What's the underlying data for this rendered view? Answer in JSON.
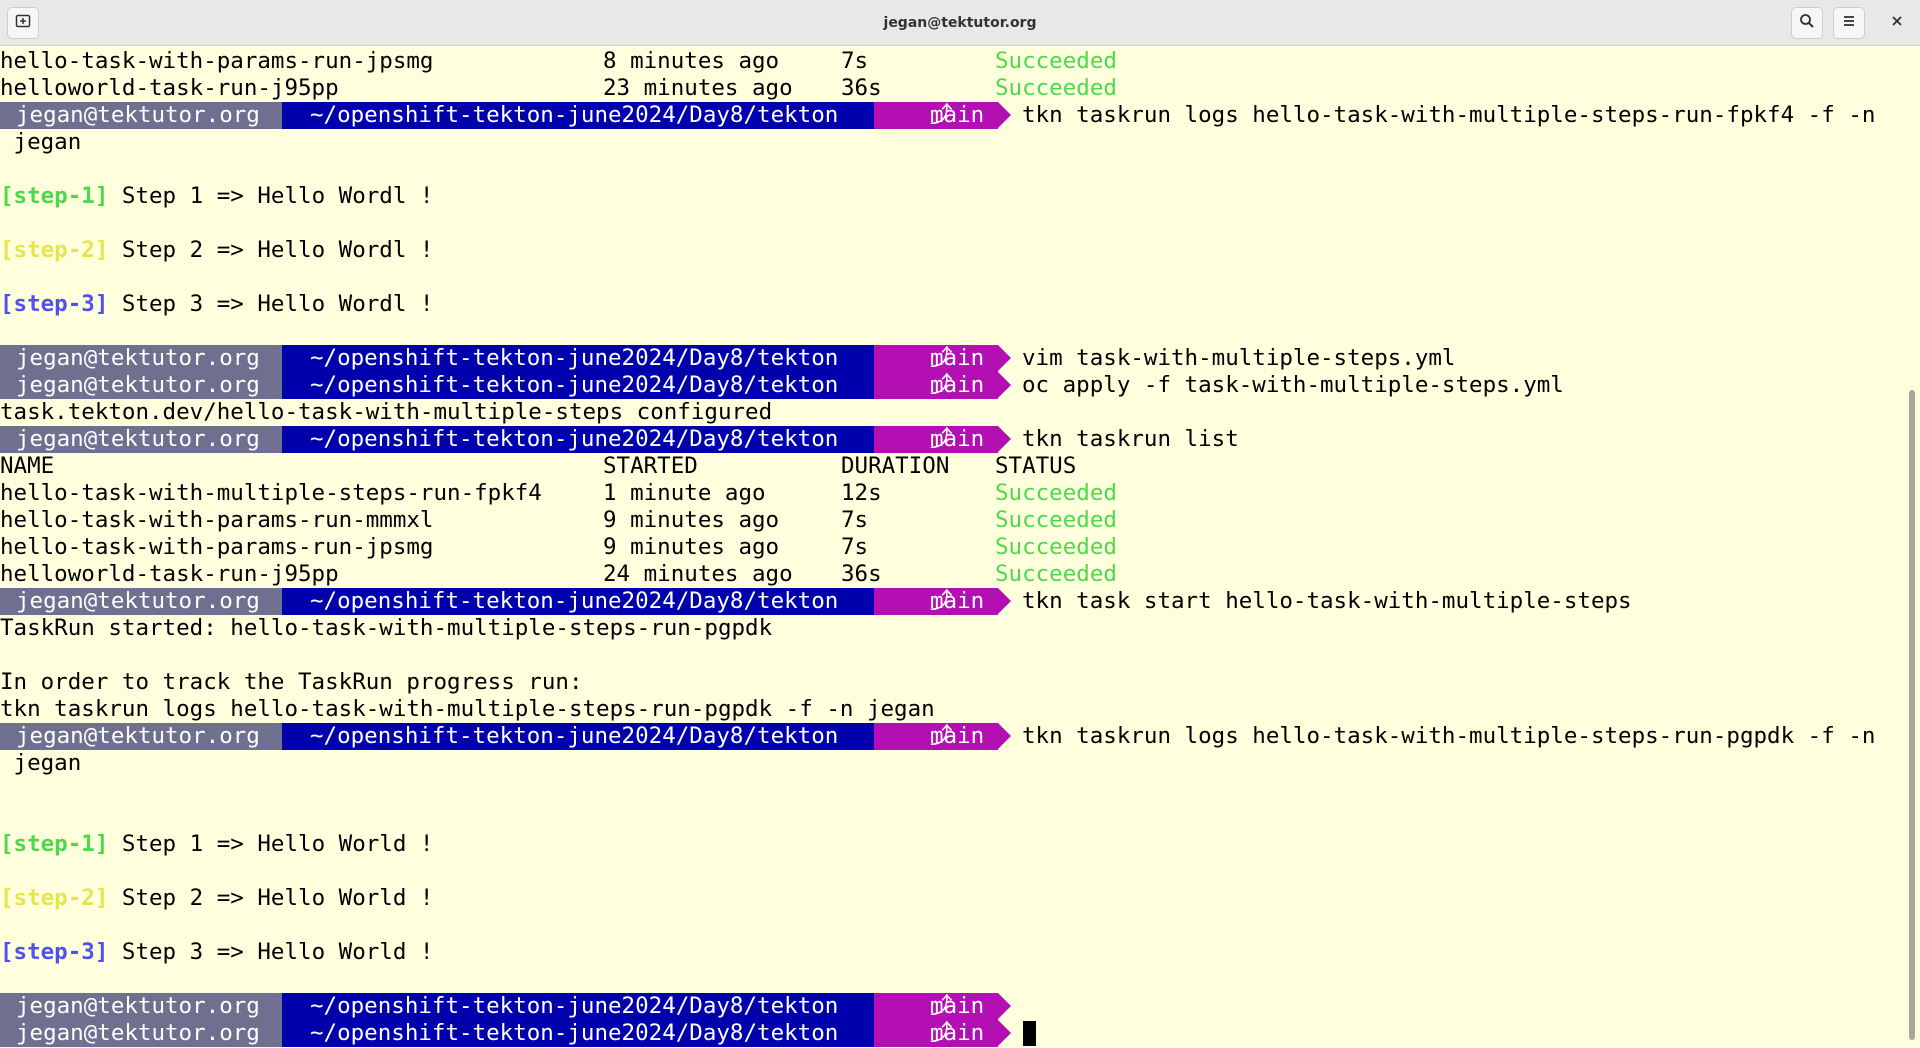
{
  "window": {
    "title": "jegan@tektutor.org"
  },
  "titlebar": {
    "new_tab_icon": "new-tab-icon",
    "search_icon": "search-icon",
    "menu_icon": "hamburger-menu-icon",
    "close_icon": "close-icon"
  },
  "prompt": {
    "user": "jegan@tektutor.org",
    "path": "~/openshift-tekton-june2024/Day8/tekton",
    "branch_glyph": "⤴",
    "branch": "main",
    "colors": {
      "user_bg": "#6f6f8f",
      "path_bg": "#0000ad",
      "git_bg": "#b30fb3",
      "text": "#ffffff"
    }
  },
  "colors": {
    "background": "#ffffdd",
    "succeeded": "#4cd94c",
    "step1": "#4cd94c",
    "step2": "#e6e64c",
    "step3": "#5050f0"
  },
  "terminal": {
    "top_list": [
      {
        "name": "hello-task-with-params-run-jpsmg",
        "started": "8 minutes ago",
        "duration": "7s",
        "status": "Succeeded"
      },
      {
        "name": "helloworld-task-run-j95pp",
        "started": "23 minutes ago",
        "duration": "36s",
        "status": "Succeeded"
      }
    ],
    "cmd1": "tkn taskrun logs hello-task-with-multiple-steps-run-fpkf4 -f -n",
    "cmd1_wrap": " jegan",
    "logs1": [
      {
        "tag": "[step-1]",
        "text": " Step 1 => Hello Wordl !"
      },
      {
        "tag": "[step-2]",
        "text": " Step 2 => Hello Wordl !"
      },
      {
        "tag": "[step-3]",
        "text": " Step 3 => Hello Wordl !"
      }
    ],
    "cmd2": "vim task-with-multiple-steps.yml",
    "cmd3": "oc apply -f task-with-multiple-steps.yml",
    "out3": "task.tekton.dev/hello-task-with-multiple-steps configured",
    "cmd4": "tkn taskrun list",
    "list_header": {
      "name": "NAME",
      "started": "STARTED",
      "duration": "DURATION",
      "status": "STATUS"
    },
    "list_rows": [
      {
        "name": "hello-task-with-multiple-steps-run-fpkf4",
        "started": "1 minute ago",
        "duration": "12s",
        "status": "Succeeded"
      },
      {
        "name": "hello-task-with-params-run-mmmxl",
        "started": "9 minutes ago",
        "duration": "7s",
        "status": "Succeeded"
      },
      {
        "name": "hello-task-with-params-run-jpsmg",
        "started": "9 minutes ago",
        "duration": "7s",
        "status": "Succeeded"
      },
      {
        "name": "helloworld-task-run-j95pp",
        "started": "24 minutes ago",
        "duration": "36s",
        "status": "Succeeded"
      }
    ],
    "cmd5": "tkn task start hello-task-with-multiple-steps",
    "out5_line1": "TaskRun started: hello-task-with-multiple-steps-run-pgpdk",
    "out5_line2": "In order to track the TaskRun progress run:",
    "out5_line3": "tkn taskrun logs hello-task-with-multiple-steps-run-pgpdk -f -n jegan",
    "cmd6": "tkn taskrun logs hello-task-with-multiple-steps-run-pgpdk -f -n",
    "cmd6_wrap": " jegan",
    "logs2": [
      {
        "tag": "[step-1]",
        "text": " Step 1 => Hello World !"
      },
      {
        "tag": "[step-2]",
        "text": " Step 2 => Hello World !"
      },
      {
        "tag": "[step-3]",
        "text": " Step 3 => Hello World !"
      }
    ]
  }
}
